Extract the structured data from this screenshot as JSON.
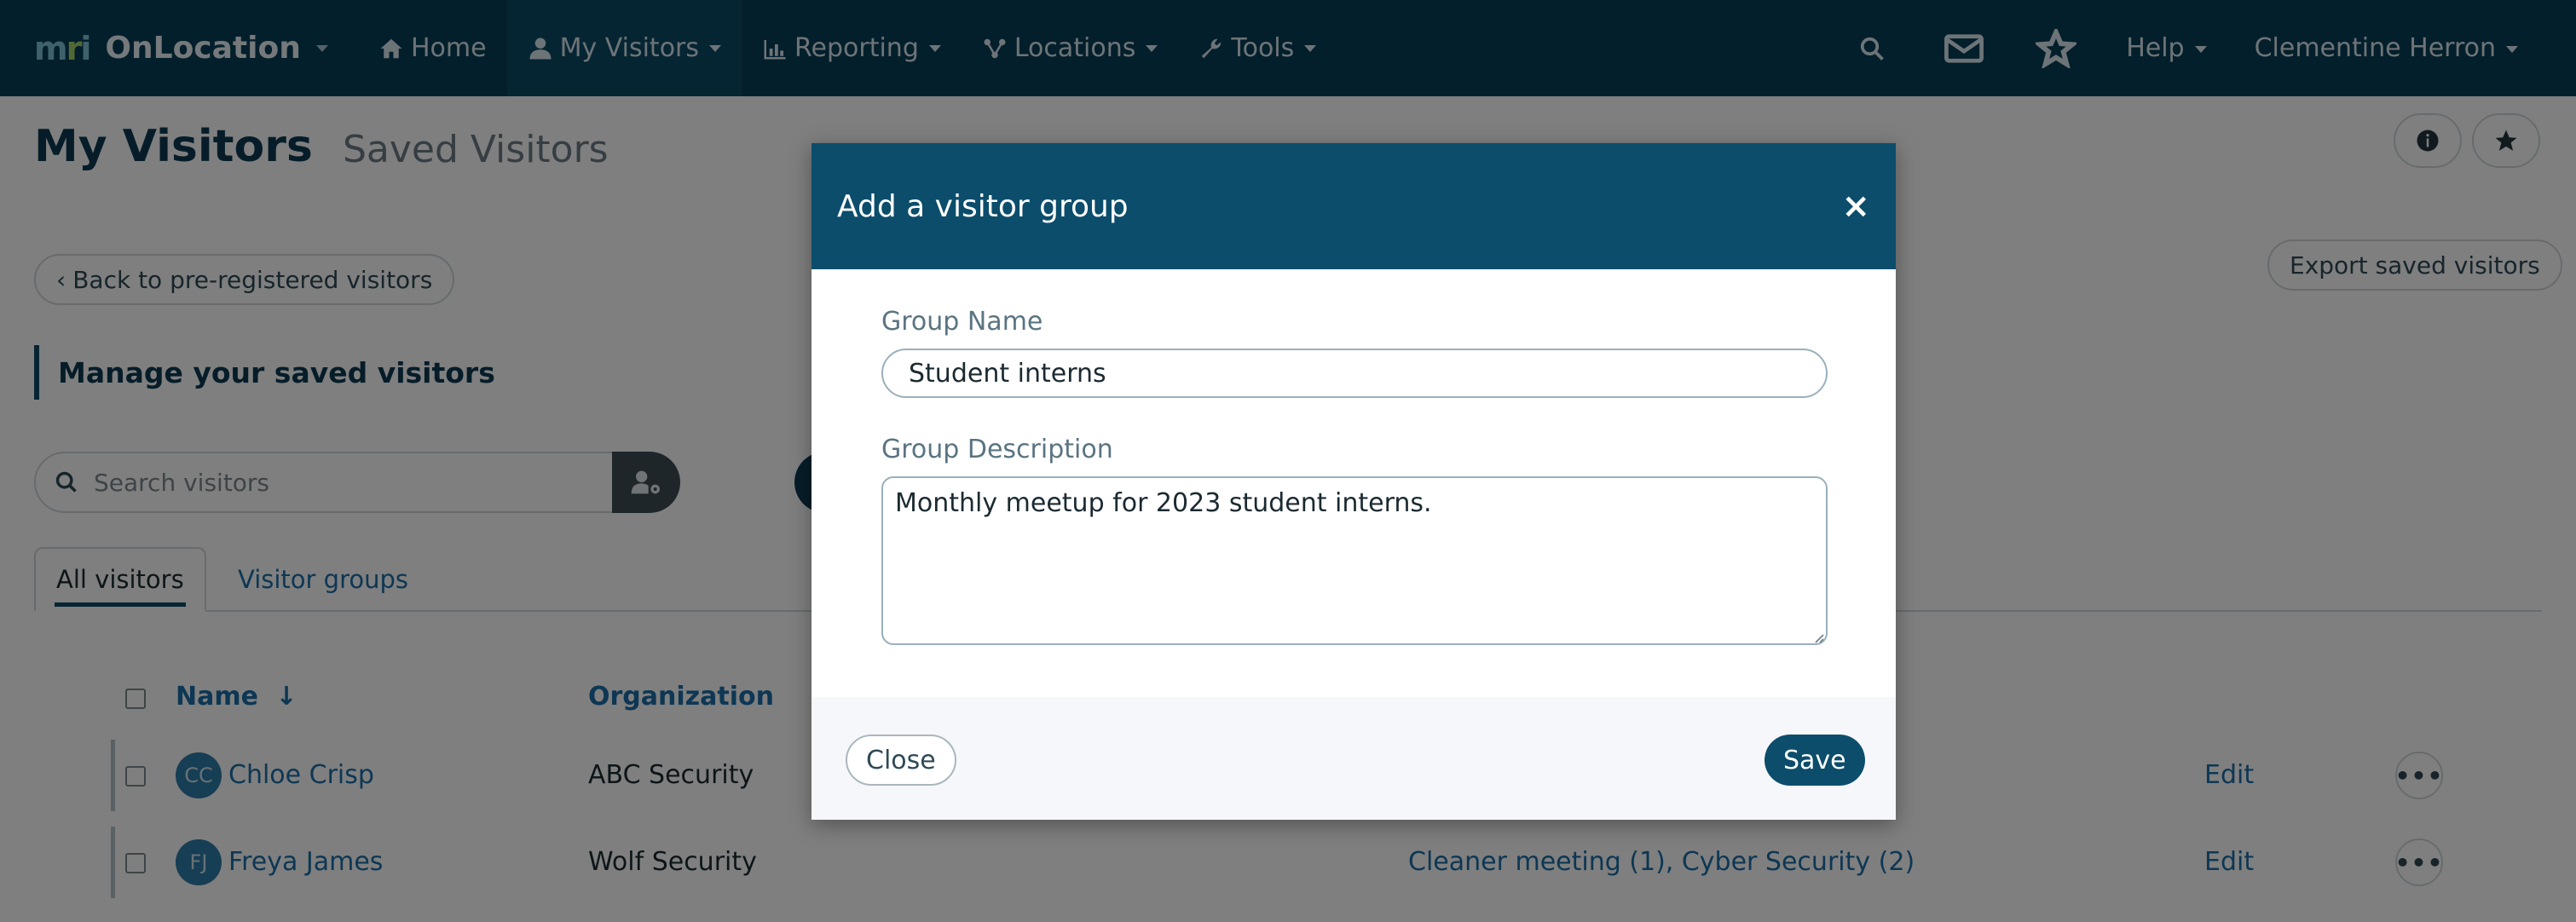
{
  "nav": {
    "brand": "OnLocation",
    "items": [
      {
        "label": "Home",
        "icon": "home-icon"
      },
      {
        "label": "My Visitors",
        "icon": "person-icon"
      },
      {
        "label": "Reporting",
        "icon": "bar-chart-icon"
      },
      {
        "label": "Locations",
        "icon": "network-icon"
      },
      {
        "label": "Tools",
        "icon": "wrench-icon"
      }
    ],
    "help": "Help",
    "user": "Clementine Herron"
  },
  "page": {
    "title": "My Visitors",
    "subtitle": "Saved Visitors",
    "back_label": "Back to pre-registered visitors",
    "export_label": "Export saved visitors",
    "section_heading": "Manage your saved visitors",
    "search_placeholder": "Search visitors"
  },
  "tabs": [
    {
      "label": "All visitors",
      "active": true
    },
    {
      "label": "Visitor groups",
      "active": false
    }
  ],
  "table": {
    "columns": [
      "Name",
      "Organization"
    ],
    "sort_indicator": "↓",
    "rows": [
      {
        "initials": "CC",
        "name": "Chloe Crisp",
        "organization": "ABC Security",
        "groups": "",
        "edit": "Edit"
      },
      {
        "initials": "FJ",
        "name": "Freya James",
        "organization": "Wolf Security",
        "groups": "Cleaner meeting (1), Cyber Security (2)",
        "edit": "Edit"
      }
    ]
  },
  "modal": {
    "title": "Add a visitor group",
    "close_symbol": "×",
    "group_name_label": "Group Name",
    "group_name_value": "Student interns",
    "group_description_label": "Group Description",
    "group_description_value": "Monthly meetup for 2023 student interns.",
    "close_button": "Close",
    "save_button": "Save"
  },
  "colors": {
    "nav_bg": "#063f57",
    "modal_header": "#0b4d6b",
    "link": "#1a6ea8",
    "primary_button": "#0b4d6b"
  }
}
